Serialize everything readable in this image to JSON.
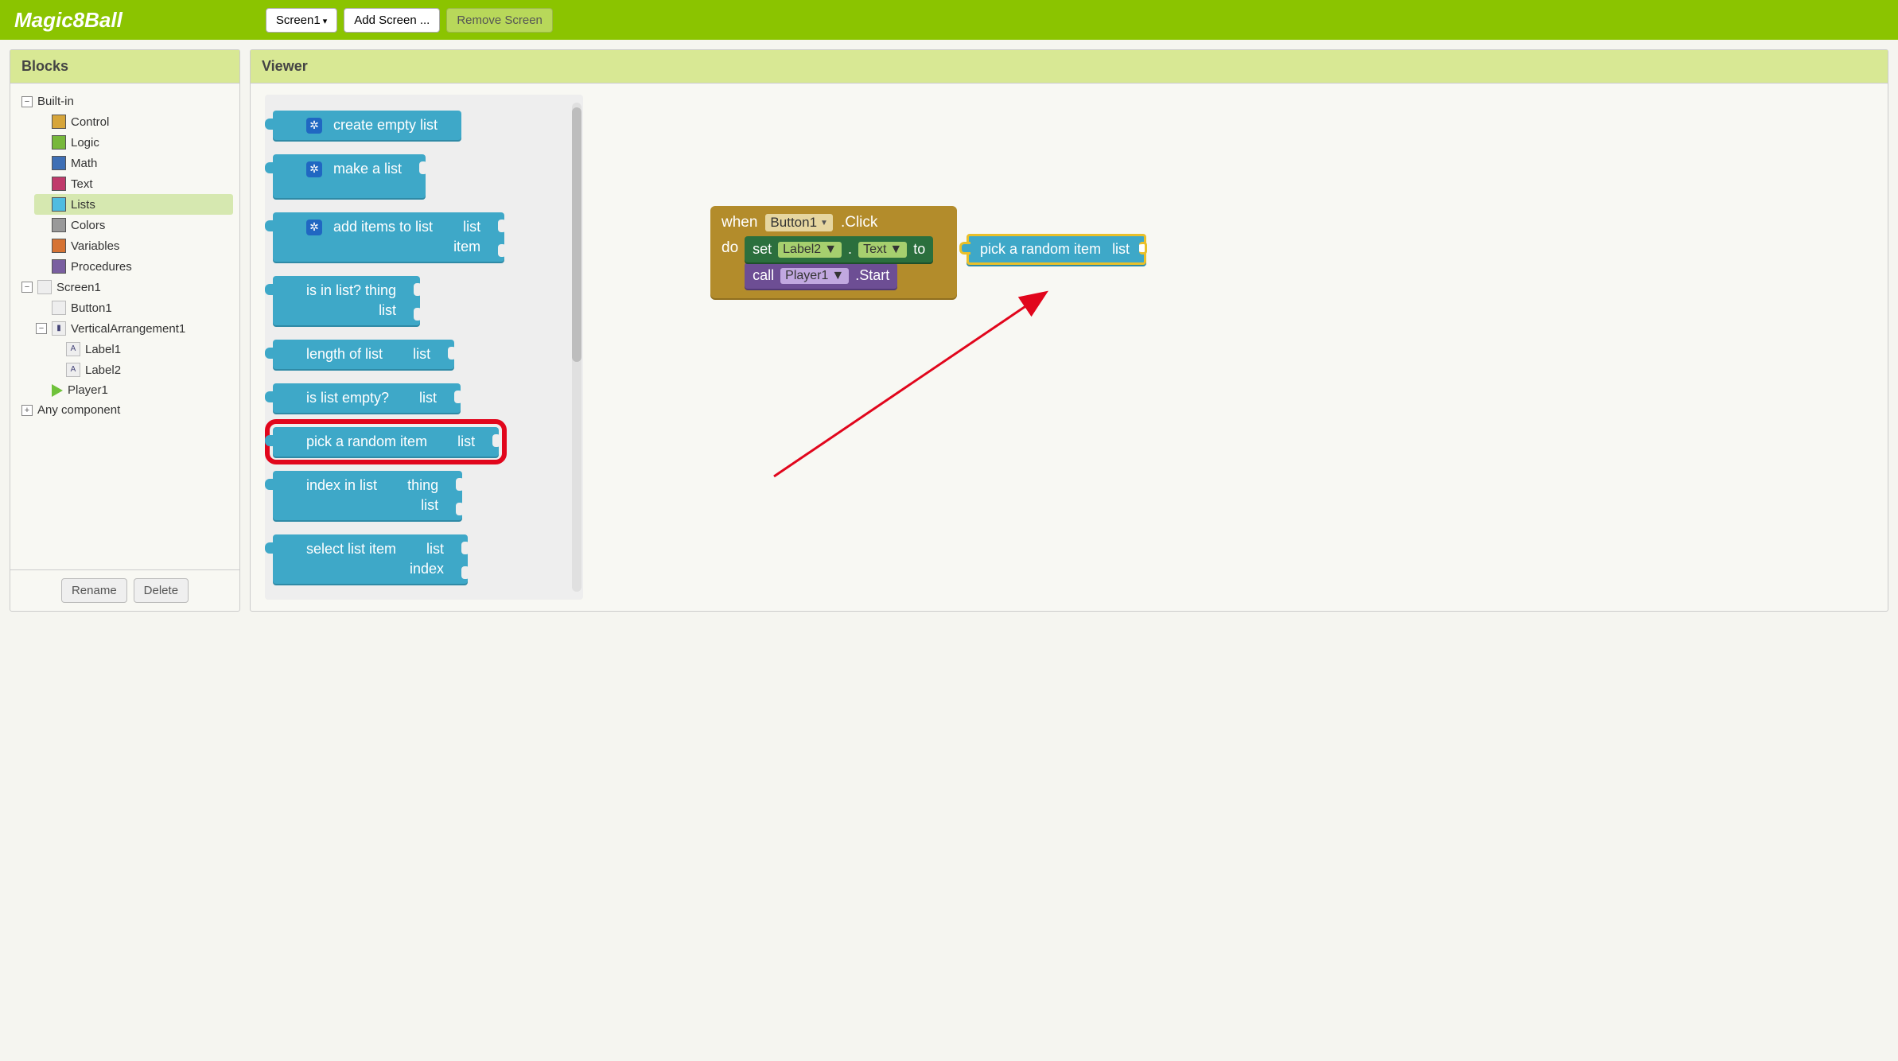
{
  "topbar": {
    "title": "Magic8Ball",
    "screen_btn": "Screen1",
    "add_btn": "Add Screen ...",
    "remove_btn": "Remove Screen"
  },
  "panels": {
    "blocks": "Blocks",
    "viewer": "Viewer"
  },
  "tree": {
    "builtin": "Built-in",
    "control": "Control",
    "logic": "Logic",
    "math": "Math",
    "text": "Text",
    "lists": "Lists",
    "colors": "Colors",
    "variables": "Variables",
    "procedures": "Procedures",
    "screen1": "Screen1",
    "button1": "Button1",
    "vertical": "VerticalArrangement1",
    "label1": "Label1",
    "label2": "Label2",
    "player1": "Player1",
    "any": "Any component"
  },
  "footer": {
    "rename": "Rename",
    "delete": "Delete"
  },
  "palette": {
    "create_empty": "create empty list",
    "make_list": "make a list",
    "add_items_a": "add items to list",
    "add_items_b": "list",
    "add_items_c": "item",
    "is_in_a": "is in list? thing",
    "is_in_b": "list",
    "length_a": "length of list",
    "length_b": "list",
    "empty_a": "is list empty?",
    "empty_b": "list",
    "pick_a": "pick a random item",
    "pick_b": "list",
    "index_a": "index in list",
    "index_b": "thing",
    "index_c": "list",
    "select_a": "select list item",
    "select_b": "list",
    "select_c": "index"
  },
  "workspace": {
    "when": "when",
    "button1": "Button1",
    "click": ".Click",
    "do": "do",
    "set": "set",
    "label2": "Label2",
    "text": "Text",
    "to": "to",
    "call": "call",
    "player1": "Player1",
    "start": ".Start",
    "pick_a": "pick a random item",
    "pick_b": "list"
  }
}
